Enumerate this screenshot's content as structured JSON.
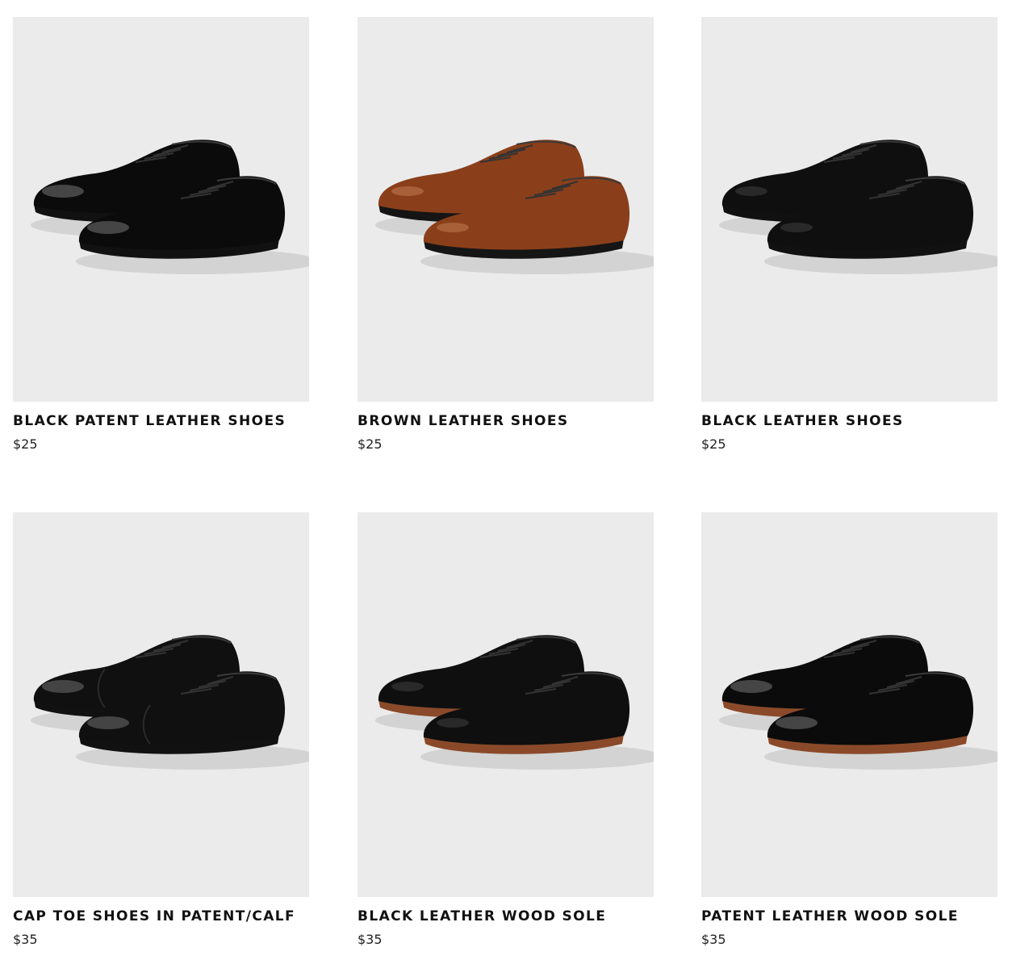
{
  "products": [
    {
      "name": "BLACK PATENT LEATHER SHOES",
      "price": "$25",
      "shoe_color": "#0b0b0b",
      "highlight_color": "#5a5a5a",
      "sole_color": "#111111",
      "cap_toe": false,
      "glossy": true
    },
    {
      "name": "BROWN LEATHER SHOES",
      "price": "$25",
      "shoe_color": "#8a3f1a",
      "highlight_color": "#c98a5c",
      "sole_color": "#151515",
      "cap_toe": false,
      "glossy": false
    },
    {
      "name": "BLACK LEATHER SHOES",
      "price": "$25",
      "shoe_color": "#0f0f0f",
      "highlight_color": "#4a4a4a",
      "sole_color": "#111111",
      "cap_toe": false,
      "glossy": false
    },
    {
      "name": "CAP TOE SHOES IN PATENT/CALF",
      "price": "$35",
      "shoe_color": "#101010",
      "highlight_color": "#555555",
      "sole_color": "#111111",
      "cap_toe": true,
      "glossy": true
    },
    {
      "name": "BLACK LEATHER WOOD SOLE",
      "price": "$35",
      "shoe_color": "#0f0f0f",
      "highlight_color": "#4a4a4a",
      "sole_color": "#8a4a2a",
      "cap_toe": false,
      "glossy": false
    },
    {
      "name": "PATENT LEATHER WOOD SOLE",
      "price": "$35",
      "shoe_color": "#0b0b0b",
      "highlight_color": "#5a5a5a",
      "sole_color": "#8a4a2a",
      "cap_toe": false,
      "glossy": true
    }
  ]
}
